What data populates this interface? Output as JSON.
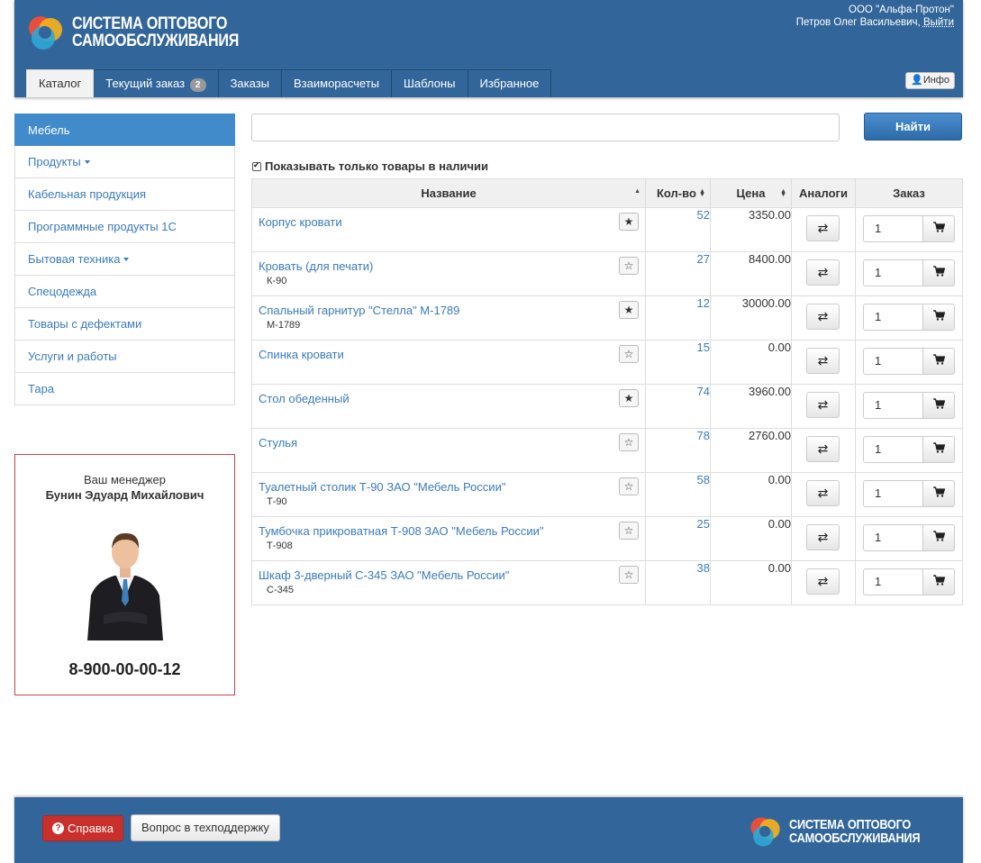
{
  "brand": {
    "line1": "СИСТЕМА ОПТОВОГО",
    "line2": "САМООБСЛУЖИВАНИЯ"
  },
  "account": {
    "company": "ООО \"Альфа-Протон\"",
    "user": "Петров Олег Васильевич,",
    "logout": "Выйти"
  },
  "nav": {
    "tabs": [
      {
        "label": "Каталог"
      },
      {
        "label": "Текущий заказ",
        "badge": "2"
      },
      {
        "label": "Заказы"
      },
      {
        "label": "Взаиморасчеты"
      },
      {
        "label": "Шаблоны"
      },
      {
        "label": "Избранное"
      }
    ],
    "info": "Инфо"
  },
  "sidebar": {
    "items": [
      {
        "label": "Мебель"
      },
      {
        "label": "Продукты"
      },
      {
        "label": "Кабельная продукция"
      },
      {
        "label": "Программные продукты 1С"
      },
      {
        "label": "Бытовая техника"
      },
      {
        "label": "Спецодежда"
      },
      {
        "label": "Товары с дефектами"
      },
      {
        "label": "Услуги и работы"
      },
      {
        "label": "Тара"
      }
    ]
  },
  "manager": {
    "label": "Ваш менеджер",
    "name": "Бунин Эдуард Михайлович",
    "phone": "8-900-00-00-12"
  },
  "search": {
    "value": "",
    "button": "Найти"
  },
  "filter": {
    "in_stock_only": "Показывать только товары в наличии",
    "checked": true
  },
  "table": {
    "headers": {
      "name": "Название",
      "qty": "Кол-во",
      "price": "Цена",
      "analogs": "Аналоги",
      "order": "Заказ"
    },
    "rows": [
      {
        "name": "Корпус кровати",
        "code": "",
        "fav": "★",
        "qty": "52",
        "price": "3350.00",
        "order_qty": "1"
      },
      {
        "name": "Кровать (для печати)",
        "code": "К-90",
        "fav": "☆",
        "qty": "27",
        "price": "8400.00",
        "order_qty": "1"
      },
      {
        "name": "Спальный гарнитур \"Стелла\" М-1789",
        "code": "М-1789",
        "fav": "★",
        "qty": "12",
        "price": "30000.00",
        "order_qty": "1"
      },
      {
        "name": "Спинка кровати",
        "code": "",
        "fav": "☆",
        "qty": "15",
        "price": "0.00",
        "order_qty": "1"
      },
      {
        "name": "Стол обеденный",
        "code": "",
        "fav": "★",
        "qty": "74",
        "price": "3960.00",
        "order_qty": "1"
      },
      {
        "name": "Стулья",
        "code": "",
        "fav": "☆",
        "qty": "78",
        "price": "2760.00",
        "order_qty": "1"
      },
      {
        "name": "Туалетный столик Т-90 ЗАО \"Мебель России\"",
        "code": "Т-90",
        "fav": "☆",
        "qty": "58",
        "price": "0.00",
        "order_qty": "1"
      },
      {
        "name": "Тумбочка прикроватная Т-908 ЗАО \"Мебель России\"",
        "code": "Т-908",
        "fav": "☆",
        "qty": "25",
        "price": "0.00",
        "order_qty": "1"
      },
      {
        "name": "Шкаф 3-дверный С-345 ЗАО \"Мебель России\"",
        "code": "С-345",
        "fav": "☆",
        "qty": "38",
        "price": "0.00",
        "order_qty": "1"
      }
    ]
  },
  "footer": {
    "help": "Справка",
    "support": "Вопрос в техподдержку"
  }
}
